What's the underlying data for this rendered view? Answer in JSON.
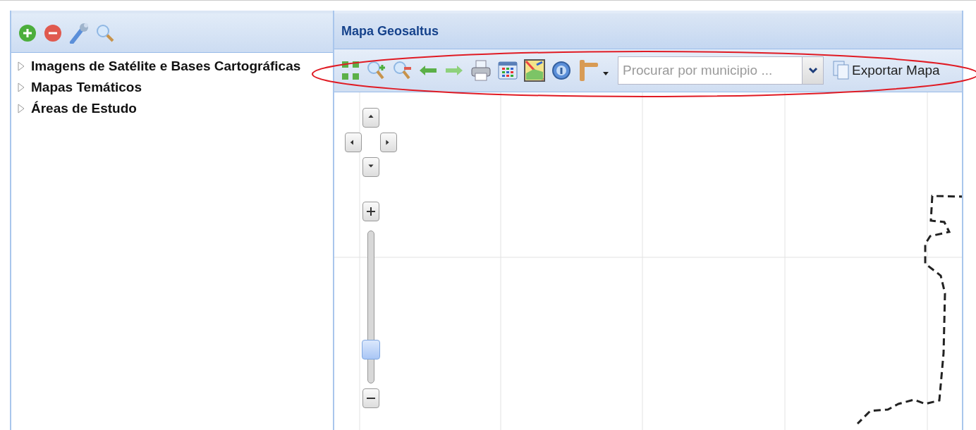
{
  "layers_panel": {
    "tree": [
      {
        "label": "Imagens de Satélite e Bases Cartográficas",
        "expanded": false
      },
      {
        "label": "Mapas Temáticos",
        "expanded": false
      },
      {
        "label": "Áreas de Estudo",
        "expanded": false
      }
    ]
  },
  "map_panel": {
    "title": "Mapa Geosaltus",
    "search": {
      "placeholder": "Procurar por municipio ..."
    },
    "export_button": "Exportar Mapa",
    "zoom": {
      "level": 0.18
    }
  }
}
